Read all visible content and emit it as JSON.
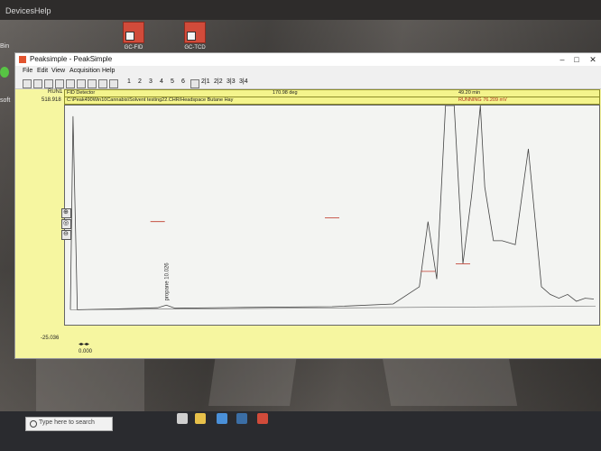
{
  "desktop": {
    "menu": [
      "Devices",
      "Help"
    ],
    "icons": [
      {
        "label": "GC-FID",
        "icon": "peaksimple-icon"
      },
      {
        "label": "GC-TCD",
        "icon": "peaksimple-icon"
      }
    ],
    "side_labels": [
      "Bin",
      "soft"
    ]
  },
  "window": {
    "title": "Peaksimple - PeakSimple",
    "menu": [
      "File",
      "Edit",
      "View",
      "Acquisition",
      "Help"
    ],
    "controls": [
      "–",
      "□",
      "✕"
    ],
    "toolbar_numbers": [
      "1",
      "2",
      "3",
      "4",
      "5",
      "6"
    ],
    "toolbar_channels": [
      "2|1",
      "2|2",
      "3|3",
      "3|4"
    ]
  },
  "chromatogram": {
    "run": "RUN1",
    "detector": "FID Detector",
    "temperature": "170.98 deg",
    "time": "49.20 min",
    "file_path": "C:\\Peak490Win10Cannabis\\Solvent testing22.CHR/Headspace Butane Hay",
    "status": "RUNNING 76.209 mV",
    "y_max": "518.918",
    "y_min": "-25.036",
    "x_start": "0.000",
    "peak_label": "propane 10.026"
  },
  "chart_data": {
    "type": "line",
    "title": "",
    "xlabel": "",
    "ylabel": "",
    "ylim": [
      -25.036,
      518.918
    ],
    "series": [
      {
        "values": [
          [
            0.0,
            0
          ],
          [
            0.3,
            505
          ],
          [
            0.8,
            0
          ],
          [
            5,
            2
          ],
          [
            10,
            5
          ],
          [
            11,
            12
          ],
          [
            12,
            4
          ],
          [
            20,
            6
          ],
          [
            30,
            8
          ],
          [
            37,
            15
          ],
          [
            40,
            60
          ],
          [
            41,
            230
          ],
          [
            42,
            80
          ],
          [
            43,
            560
          ],
          [
            44,
            560
          ],
          [
            45,
            120
          ],
          [
            46,
            300
          ],
          [
            47,
            560
          ],
          [
            47.5,
            320
          ],
          [
            48.5,
            180
          ],
          [
            49.5,
            180
          ],
          [
            51,
            170
          ],
          [
            52.5,
            420
          ],
          [
            54,
            60
          ],
          [
            55,
            40
          ],
          [
            56,
            30
          ],
          [
            57,
            40
          ],
          [
            58,
            22
          ],
          [
            59,
            30
          ],
          [
            60,
            28
          ]
        ]
      }
    ],
    "annotations": [
      "propane 10.026"
    ],
    "grid": false
  },
  "taskbar": {
    "search_placeholder": "Type here to search",
    "icons": [
      "task-view-icon",
      "file-explorer-icon",
      "store-icon",
      "mail-icon",
      "peaksimple-icon"
    ]
  },
  "colors": {
    "chrom_bg": "#f6f6a0",
    "trace": "#444444",
    "marker": "#c0392b"
  }
}
